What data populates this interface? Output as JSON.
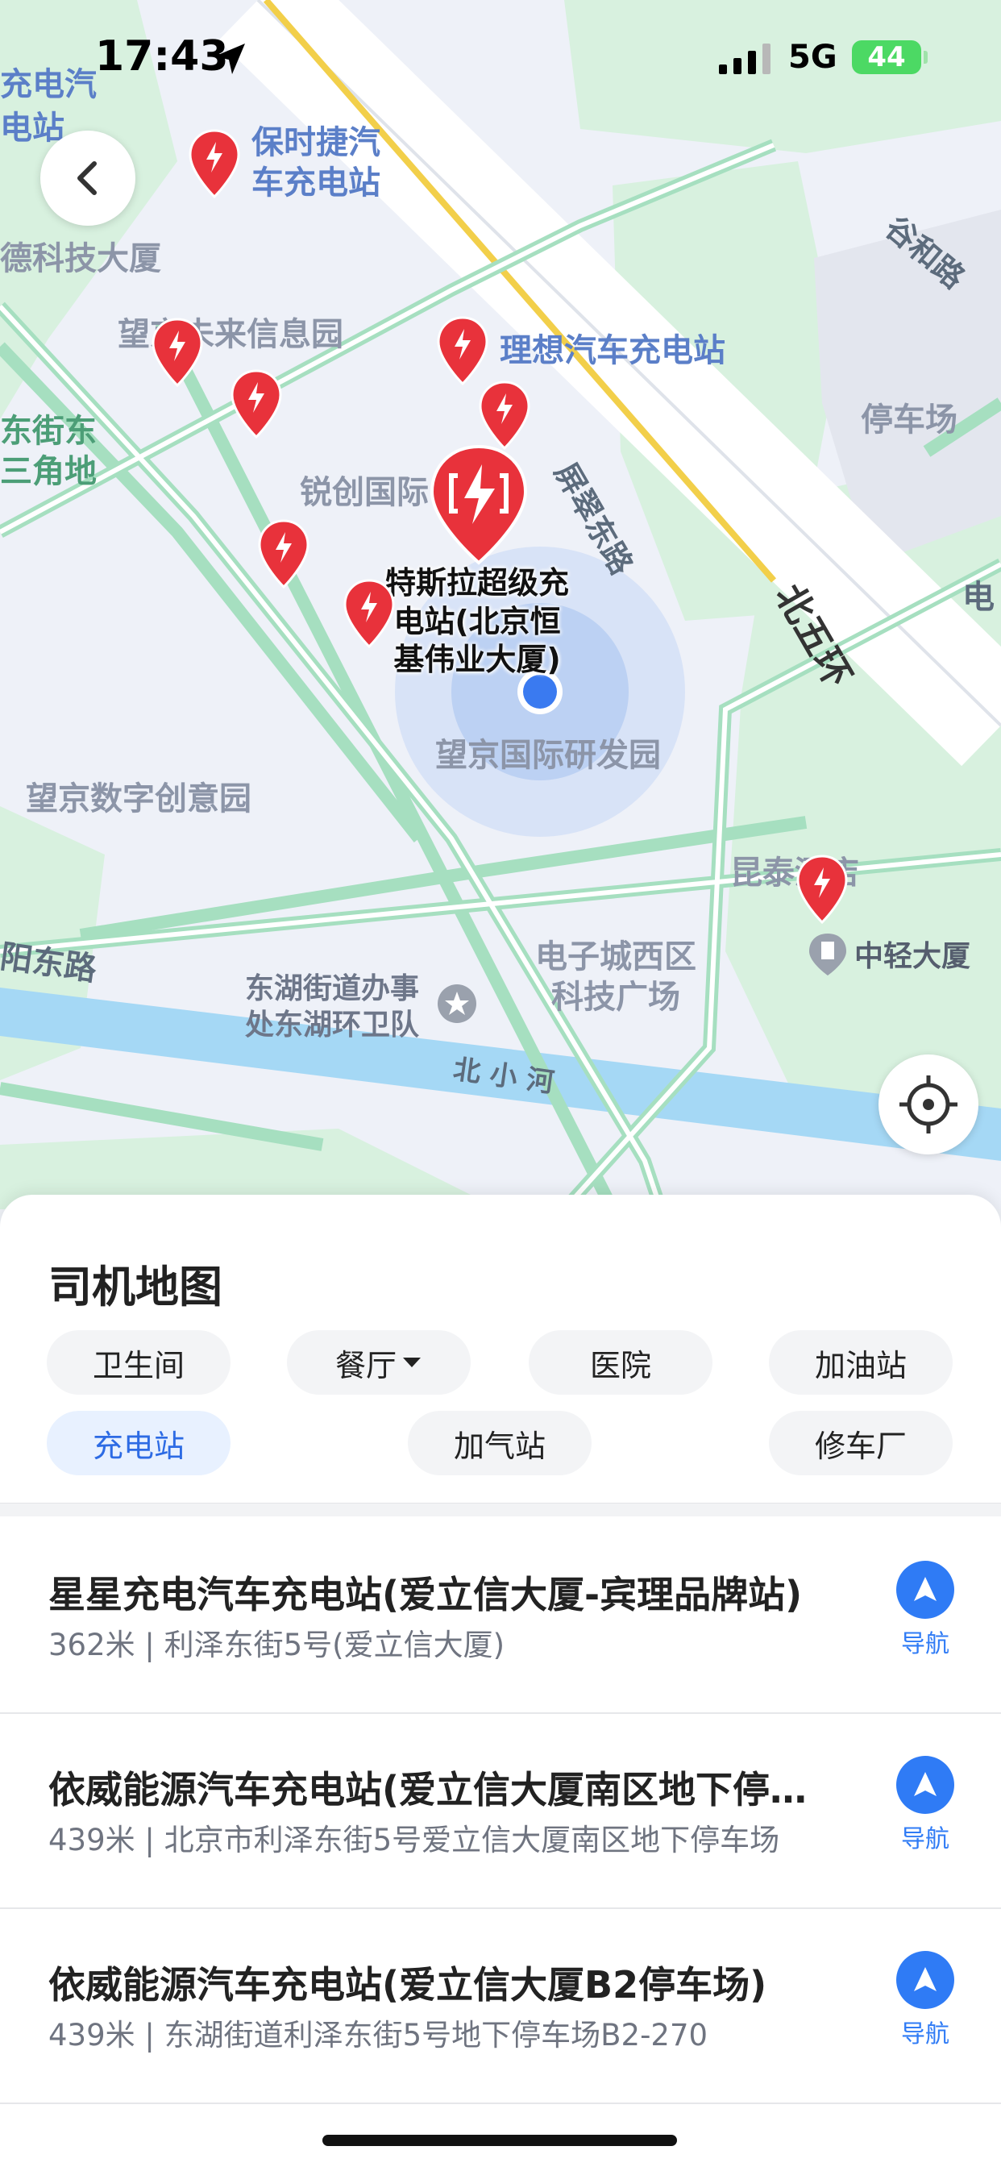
{
  "status_bar": {
    "time": "17:43",
    "network": "5G",
    "battery": "44"
  },
  "map": {
    "labels": {
      "top_left_a": "充电汽",
      "top_left_b": "电站",
      "porsche": "保时捷汽\n车充电站",
      "tech_building": "德科技大厦",
      "wangjing_future": "望京未来信息园",
      "lixiang": "理想汽车充电站",
      "guhe_road": "谷和路",
      "parking": "停车场",
      "east_street": "东街东\n三角地",
      "ruichuang": "锐创国际",
      "pingcui_road": "屏翠东路",
      "north_5th_ring": "北五环",
      "tesla": "特斯拉超级充\n电站(北京恒\n基伟业大厦)",
      "rd_park": "望京国际研发园",
      "digital_park": "望京数字创意园",
      "kuntai": "昆泰酒店",
      "zhongqing": "中轻大厦",
      "yang_east_road": "阳东路",
      "electronic_city": "电子城西区\n科技广场",
      "donghu": "东湖街道办事\n处东湖环卫队",
      "beixiao_river": "北 小 河",
      "right_edge": "电"
    }
  },
  "sheet": {
    "title": "司机地图",
    "filters": {
      "restroom": "卫生间",
      "restaurant": "餐厅",
      "hospital": "医院",
      "gas_station": "加油站",
      "charging_station": "充电站",
      "cng_station": "加气站",
      "repair_shop": "修车厂"
    },
    "results": [
      {
        "name": "星星充电汽车充电站(爱立信大厦-宾理品牌站)",
        "meta": "362米 | 利泽东街5号(爱立信大厦)",
        "nav": "导航"
      },
      {
        "name": "依威能源汽车充电站(爱立信大厦南区地下停…",
        "meta": "439米 | 北京市利泽东街5号爱立信大厦南区地下停车场",
        "nav": "导航"
      },
      {
        "name": "依威能源汽车充电站(爱立信大厦B2停车场)",
        "meta": "439米 | 东湖街道利泽东街5号地下停车场B2-270",
        "nav": "导航"
      }
    ]
  },
  "colors": {
    "accent": "#2f7bf5",
    "pin_red": "#e8323b",
    "road_green": "#a6dfc0",
    "river_blue": "#a5d8f5"
  }
}
